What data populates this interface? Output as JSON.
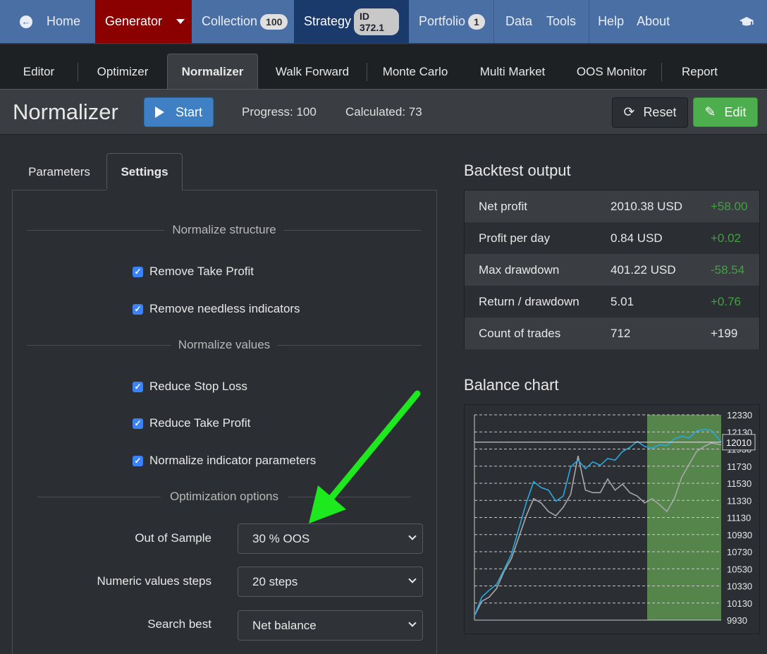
{
  "topnav": {
    "home": "Home",
    "generator": "Generator",
    "collection": "Collection",
    "collection_count": "100",
    "strategy": "Strategy",
    "strategy_id": "ID 372.1",
    "portfolio": "Portfolio",
    "portfolio_count": "1",
    "data": "Data",
    "tools": "Tools",
    "help": "Help",
    "about": "About"
  },
  "subnav": {
    "tabs": [
      "Editor",
      "Optimizer",
      "Normalizer",
      "Walk Forward",
      "Monte Carlo",
      "Multi Market",
      "OOS Monitor",
      "Report"
    ],
    "active": "Normalizer"
  },
  "toolbar": {
    "title": "Normalizer",
    "start_label": "Start",
    "progress": "Progress: 100",
    "calculated": "Calculated: 73",
    "reset_label": "Reset",
    "edit_label": "Edit"
  },
  "left": {
    "tabs": [
      "Parameters",
      "Settings"
    ],
    "active_tab": "Settings",
    "sections": {
      "structure": "Normalize structure",
      "values": "Normalize values",
      "optimization": "Optimization options"
    },
    "checks": {
      "remove_tp": "Remove Take Profit",
      "remove_indicators": "Remove needless indicators",
      "reduce_sl": "Reduce Stop Loss",
      "reduce_tp": "Reduce Take Profit",
      "normalize_params": "Normalize indicator parameters"
    },
    "fields": {
      "oos_label": "Out of Sample",
      "oos_value": "30 % OOS",
      "steps_label": "Numeric values steps",
      "steps_value": "20 steps",
      "search_label": "Search best",
      "search_value": "Net balance"
    }
  },
  "backtest": {
    "title": "Backtest output",
    "rows": [
      {
        "label": "Net profit",
        "value": "2010.38 USD",
        "delta": "+58.00",
        "delta_color": "#3fa33f"
      },
      {
        "label": "Profit per day",
        "value": "0.84 USD",
        "delta": "+0.02",
        "delta_color": "#3fa33f"
      },
      {
        "label": "Max drawdown",
        "value": "401.22 USD",
        "delta": "-58.54",
        "delta_color": "#3fa33f"
      },
      {
        "label": "Return / drawdown",
        "value": "5.01",
        "delta": "+0.76",
        "delta_color": "#3fa33f"
      },
      {
        "label": "Count of trades",
        "value": "712",
        "delta": "+199",
        "delta_color": "#e8e8e8"
      }
    ]
  },
  "balance_chart": {
    "title": "Balance chart",
    "current_value": "12010"
  },
  "chart_data": {
    "type": "line",
    "title": "Balance chart",
    "y_ticks": [
      12330,
      12130,
      11930,
      11730,
      11530,
      11330,
      11130,
      10930,
      10730,
      10530,
      10330,
      10130,
      9930
    ],
    "ylim": [
      9930,
      12330
    ],
    "xlim": [
      0,
      100
    ],
    "oos_region": [
      70,
      100
    ],
    "grid": true,
    "series": [
      {
        "color": "#29a8e0",
        "x": [
          0,
          3,
          6,
          9,
          12,
          15,
          18,
          21,
          24,
          27,
          30,
          33,
          36,
          39,
          42,
          45,
          48,
          51,
          54,
          57,
          60,
          63,
          66,
          69,
          72,
          75,
          78,
          81,
          84,
          87,
          90,
          93,
          96,
          100
        ],
        "values": [
          9980,
          10200,
          10280,
          10350,
          10520,
          10700,
          11000,
          11300,
          11550,
          11480,
          11450,
          11320,
          11380,
          11720,
          11800,
          11700,
          11780,
          11740,
          11820,
          11800,
          11900,
          11950,
          12020,
          11960,
          11940,
          11980,
          11970,
          12050,
          12080,
          12060,
          12140,
          12160,
          12150,
          12010
        ]
      },
      {
        "color": "#a8a8a8",
        "x": [
          0,
          3,
          6,
          9,
          12,
          15,
          18,
          21,
          24,
          27,
          30,
          33,
          36,
          39,
          42,
          45,
          48,
          51,
          54,
          57,
          60,
          63,
          66,
          69,
          72,
          75,
          78,
          81,
          84,
          87,
          90,
          93,
          96,
          100
        ],
        "values": [
          9980,
          10150,
          10200,
          10300,
          10500,
          10650,
          10900,
          11150,
          11350,
          11300,
          11200,
          11150,
          11250,
          11400,
          11850,
          11450,
          11420,
          11420,
          11580,
          11450,
          11520,
          11420,
          11380,
          11300,
          11350,
          11280,
          11200,
          11350,
          11600,
          11750,
          11900,
          11960,
          12000,
          11980
        ]
      }
    ]
  },
  "colors": {
    "accent": "#4a6fa5",
    "generator": "#8b0000",
    "strategy": "#1a3a6b",
    "start": "#3f7fc4",
    "edit": "#4cae4c",
    "oos_region": "#5a8f4e",
    "arrow": "#1ee81e"
  }
}
